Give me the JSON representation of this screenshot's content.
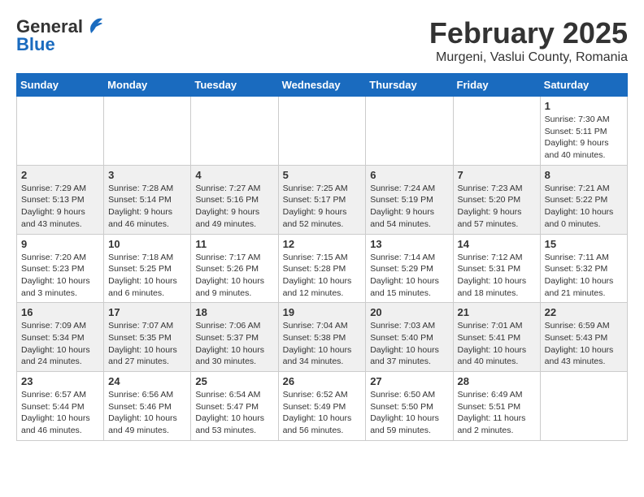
{
  "header": {
    "logo_line1": "General",
    "logo_line2": "Blue",
    "title": "February 2025",
    "subtitle": "Murgeni, Vaslui County, Romania"
  },
  "days_of_week": [
    "Sunday",
    "Monday",
    "Tuesday",
    "Wednesday",
    "Thursday",
    "Friday",
    "Saturday"
  ],
  "weeks": [
    [
      {
        "day": "",
        "info": ""
      },
      {
        "day": "",
        "info": ""
      },
      {
        "day": "",
        "info": ""
      },
      {
        "day": "",
        "info": ""
      },
      {
        "day": "",
        "info": ""
      },
      {
        "day": "",
        "info": ""
      },
      {
        "day": "1",
        "info": "Sunrise: 7:30 AM\nSunset: 5:11 PM\nDaylight: 9 hours and 40 minutes."
      }
    ],
    [
      {
        "day": "2",
        "info": "Sunrise: 7:29 AM\nSunset: 5:13 PM\nDaylight: 9 hours and 43 minutes."
      },
      {
        "day": "3",
        "info": "Sunrise: 7:28 AM\nSunset: 5:14 PM\nDaylight: 9 hours and 46 minutes."
      },
      {
        "day": "4",
        "info": "Sunrise: 7:27 AM\nSunset: 5:16 PM\nDaylight: 9 hours and 49 minutes."
      },
      {
        "day": "5",
        "info": "Sunrise: 7:25 AM\nSunset: 5:17 PM\nDaylight: 9 hours and 52 minutes."
      },
      {
        "day": "6",
        "info": "Sunrise: 7:24 AM\nSunset: 5:19 PM\nDaylight: 9 hours and 54 minutes."
      },
      {
        "day": "7",
        "info": "Sunrise: 7:23 AM\nSunset: 5:20 PM\nDaylight: 9 hours and 57 minutes."
      },
      {
        "day": "8",
        "info": "Sunrise: 7:21 AM\nSunset: 5:22 PM\nDaylight: 10 hours and 0 minutes."
      }
    ],
    [
      {
        "day": "9",
        "info": "Sunrise: 7:20 AM\nSunset: 5:23 PM\nDaylight: 10 hours and 3 minutes."
      },
      {
        "day": "10",
        "info": "Sunrise: 7:18 AM\nSunset: 5:25 PM\nDaylight: 10 hours and 6 minutes."
      },
      {
        "day": "11",
        "info": "Sunrise: 7:17 AM\nSunset: 5:26 PM\nDaylight: 10 hours and 9 minutes."
      },
      {
        "day": "12",
        "info": "Sunrise: 7:15 AM\nSunset: 5:28 PM\nDaylight: 10 hours and 12 minutes."
      },
      {
        "day": "13",
        "info": "Sunrise: 7:14 AM\nSunset: 5:29 PM\nDaylight: 10 hours and 15 minutes."
      },
      {
        "day": "14",
        "info": "Sunrise: 7:12 AM\nSunset: 5:31 PM\nDaylight: 10 hours and 18 minutes."
      },
      {
        "day": "15",
        "info": "Sunrise: 7:11 AM\nSunset: 5:32 PM\nDaylight: 10 hours and 21 minutes."
      }
    ],
    [
      {
        "day": "16",
        "info": "Sunrise: 7:09 AM\nSunset: 5:34 PM\nDaylight: 10 hours and 24 minutes."
      },
      {
        "day": "17",
        "info": "Sunrise: 7:07 AM\nSunset: 5:35 PM\nDaylight: 10 hours and 27 minutes."
      },
      {
        "day": "18",
        "info": "Sunrise: 7:06 AM\nSunset: 5:37 PM\nDaylight: 10 hours and 30 minutes."
      },
      {
        "day": "19",
        "info": "Sunrise: 7:04 AM\nSunset: 5:38 PM\nDaylight: 10 hours and 34 minutes."
      },
      {
        "day": "20",
        "info": "Sunrise: 7:03 AM\nSunset: 5:40 PM\nDaylight: 10 hours and 37 minutes."
      },
      {
        "day": "21",
        "info": "Sunrise: 7:01 AM\nSunset: 5:41 PM\nDaylight: 10 hours and 40 minutes."
      },
      {
        "day": "22",
        "info": "Sunrise: 6:59 AM\nSunset: 5:43 PM\nDaylight: 10 hours and 43 minutes."
      }
    ],
    [
      {
        "day": "23",
        "info": "Sunrise: 6:57 AM\nSunset: 5:44 PM\nDaylight: 10 hours and 46 minutes."
      },
      {
        "day": "24",
        "info": "Sunrise: 6:56 AM\nSunset: 5:46 PM\nDaylight: 10 hours and 49 minutes."
      },
      {
        "day": "25",
        "info": "Sunrise: 6:54 AM\nSunset: 5:47 PM\nDaylight: 10 hours and 53 minutes."
      },
      {
        "day": "26",
        "info": "Sunrise: 6:52 AM\nSunset: 5:49 PM\nDaylight: 10 hours and 56 minutes."
      },
      {
        "day": "27",
        "info": "Sunrise: 6:50 AM\nSunset: 5:50 PM\nDaylight: 10 hours and 59 minutes."
      },
      {
        "day": "28",
        "info": "Sunrise: 6:49 AM\nSunset: 5:51 PM\nDaylight: 11 hours and 2 minutes."
      },
      {
        "day": "",
        "info": ""
      }
    ]
  ]
}
